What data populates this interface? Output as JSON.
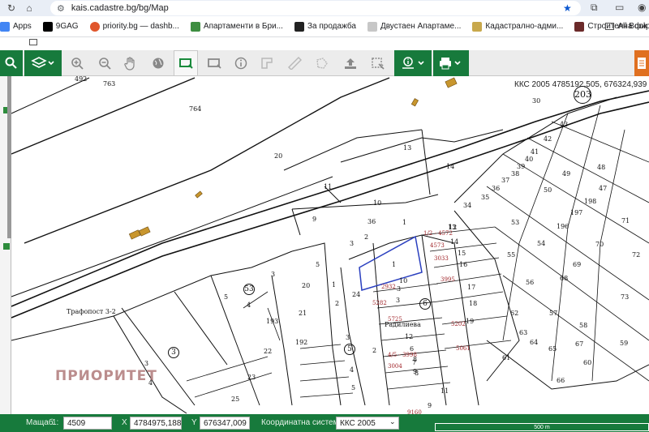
{
  "browser": {
    "url": "kais.cadastre.bg/bg/Map"
  },
  "bookmarks": [
    {
      "label": "Apps",
      "color": "#4285f4"
    },
    {
      "label": "9GAG",
      "color": "#000000"
    },
    {
      "label": "priority.bg — dashb...",
      "color": "#e0562c"
    },
    {
      "label": "Апартаменти в Бри...",
      "color": "#3e8e41"
    },
    {
      "label": "За продажба",
      "color": "#222222"
    },
    {
      "label": "Двустаен Апартаме...",
      "color": "#c7c7c7"
    },
    {
      "label": "Кадастрално-адми...",
      "color": "#c8a84c"
    },
    {
      "label": "Строителна фирма...",
      "color": "#6b2a2a"
    }
  ],
  "bookmarks_all": "All Book",
  "map": {
    "coord_header": "ККС 2005 4785192,505, 676324,939",
    "watermark": "ПРИОРИТЕТ",
    "parcel_labels": [
      "492",
      "763",
      "764",
      "20",
      "13",
      "14",
      "11",
      "10",
      "9",
      "36",
      "1",
      "3",
      "2",
      "5",
      "4",
      "3",
      "20",
      "21",
      "193",
      "192",
      "22",
      "1",
      "2",
      "24",
      "3",
      "4",
      "5",
      "23",
      "25",
      "12",
      "9",
      "8",
      "2",
      "1",
      "3",
      "43",
      "48",
      "42",
      "41",
      "40",
      "39",
      "38",
      "37",
      "36",
      "35",
      "34",
      "30",
      "50",
      "49",
      "198",
      "47",
      "71",
      "55",
      "54",
      "196",
      "197",
      "70",
      "72",
      "53",
      "56",
      "69",
      "68",
      "73",
      "62",
      "57",
      "67",
      "63",
      "64",
      "65",
      "66",
      "60",
      "61",
      "58",
      "59",
      "3",
      "4",
      "5",
      "19",
      "18",
      "17",
      "16",
      "15",
      "14",
      "13",
      "12",
      "6",
      "7",
      "8",
      "9",
      "11",
      "10",
      "3",
      "2"
    ],
    "red_labels": [
      "1/2 - 4572",
      "4573",
      "3033",
      "3995",
      "2932",
      "5282",
      "5725",
      "5202",
      "4/5 - 3998",
      "3004",
      "5061",
      "9160"
    ],
    "circled_numbers": [
      "203",
      "3",
      "5",
      "6",
      "53"
    ],
    "place_names": [
      "Радилиева",
      "Трафопост 3-2"
    ]
  },
  "status": {
    "scale_label": "Мащаб",
    "scale_prefix": "1:",
    "scale_value": "4509",
    "x_label": "X",
    "x_value": "4784975,188",
    "y_label": "Y",
    "y_value": "676347,009",
    "crs_label": "Координатна система",
    "crs_value": "ККС 2005",
    "scalebar_text": "500 m"
  },
  "colors": {
    "toolbar_green": "#177a3c",
    "print_orange": "#e07020"
  }
}
